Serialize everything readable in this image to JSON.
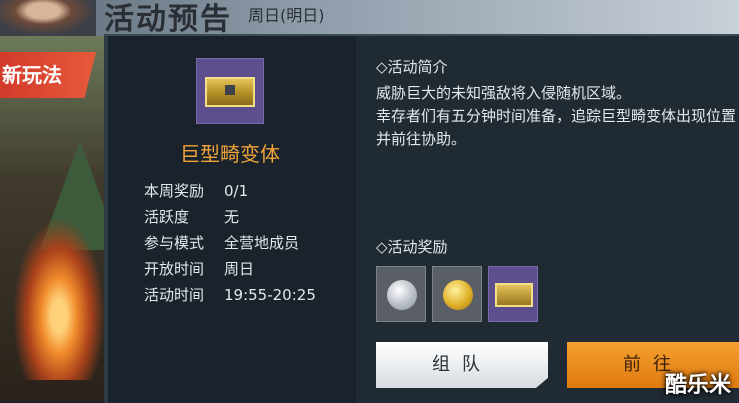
{
  "header": {
    "title": "活动预告",
    "subtitle": "周日(明日)"
  },
  "side_banner": {
    "label": "新玩法"
  },
  "event": {
    "name": "巨型畸变体",
    "icon": "aberration-chest-icon",
    "info": [
      {
        "key": "本周奖励",
        "value": "0/1"
      },
      {
        "key": "活跃度",
        "value": "无"
      },
      {
        "key": "参与模式",
        "value": "全营地成员"
      },
      {
        "key": "开放时间",
        "value": "周日"
      },
      {
        "key": "活动时间",
        "value": "19:55-20:25"
      }
    ]
  },
  "intro": {
    "title": "◇活动简介",
    "lines": [
      "威胁巨大的未知强敌将入侵随机区域。",
      "幸存者们有五分钟时间准备，追踪巨型畸变体出现位置并前往协助。"
    ]
  },
  "rewards": {
    "title": "◇活动奖励",
    "items": [
      {
        "icon": "silver-coin-icon"
      },
      {
        "icon": "gold-coin-icon"
      },
      {
        "icon": "reward-chest-icon"
      }
    ]
  },
  "buttons": {
    "team": "组队",
    "go": "前往"
  },
  "watermark": "酷乐米",
  "colors": {
    "accent_orange": "#f0a43a",
    "panel_bg": "#202a33",
    "banner_red": "#d23a2a"
  }
}
